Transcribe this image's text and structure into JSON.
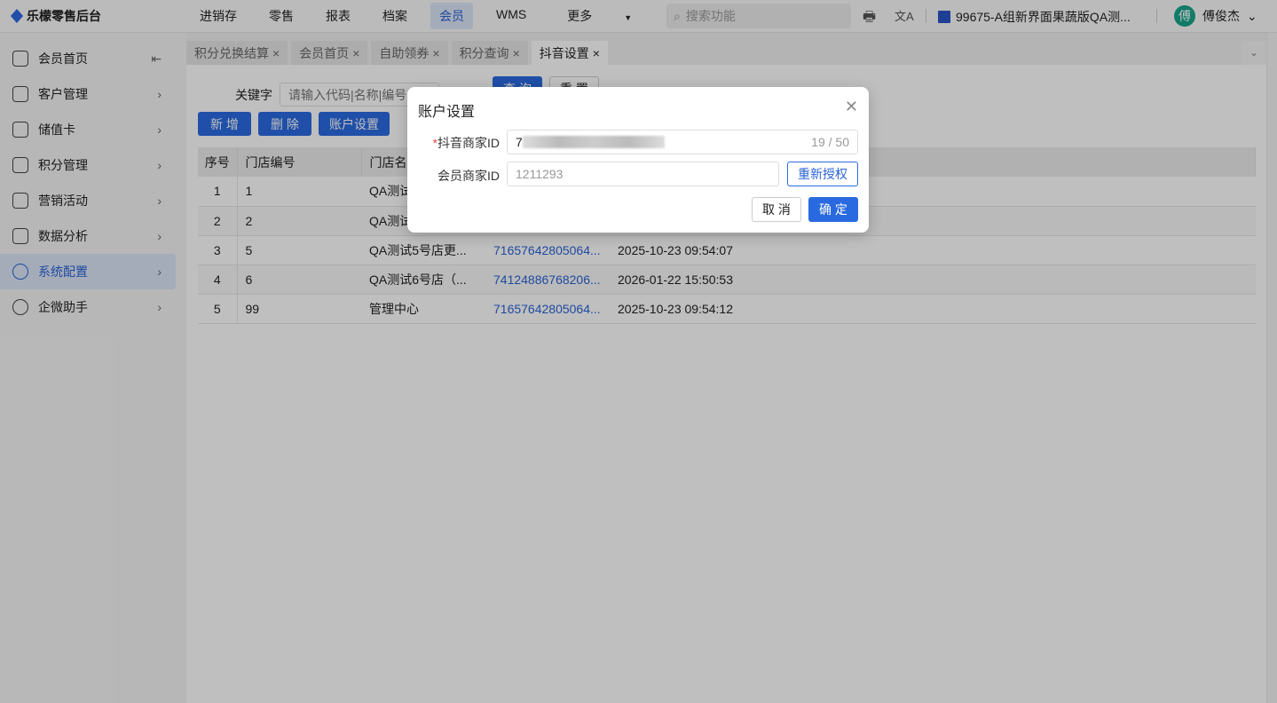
{
  "app": {
    "title": "乐檬零售后台"
  },
  "nav": [
    "进销存",
    "零售",
    "报表",
    "档案",
    "会员",
    "WMS",
    "更多"
  ],
  "nav_active": "会员",
  "search": {
    "placeholder": "搜索功能"
  },
  "store": "99675-A组新界面果蔬版QA测...",
  "user": {
    "avatar": "傅",
    "name": "傅俊杰"
  },
  "sidebar": [
    {
      "label": "会员首页"
    },
    {
      "label": "客户管理"
    },
    {
      "label": "储值卡"
    },
    {
      "label": "积分管理"
    },
    {
      "label": "营销活动"
    },
    {
      "label": "数据分析"
    },
    {
      "label": "系统配置"
    },
    {
      "label": "企微助手"
    }
  ],
  "tabs": [
    "积分兑换结算",
    "会员首页",
    "自助领券",
    "积分查询",
    "抖音设置"
  ],
  "filter": {
    "label": "关键字",
    "placeholder": "请输入代码|名称|编号",
    "query": "查 询",
    "reset": "重 置"
  },
  "toolbar": {
    "add": "新 增",
    "delete": "删 除",
    "account": "账户设置"
  },
  "table": {
    "headers": [
      "序号",
      "门店编号",
      "门店名"
    ],
    "rows": [
      [
        "1",
        "1",
        "QA测试",
        "",
        ""
      ],
      [
        "2",
        "2",
        "QA测试",
        "",
        ""
      ],
      [
        "3",
        "5",
        "QA测试5号店更...",
        "71657642805064...",
        "2025-10-23 09:54:07"
      ],
      [
        "4",
        "6",
        "QA测试6号店（...",
        "74124886768206...",
        "2026-01-22 15:50:53"
      ],
      [
        "5",
        "99",
        "管理中心",
        "71657642805064...",
        "2025-10-23 09:54:12"
      ]
    ]
  },
  "dialog": {
    "title": "账户设置",
    "douyin_label": "抖音商家ID",
    "douyin_value": "7",
    "douyin_count": "19 / 50",
    "member_label": "会员商家ID",
    "member_placeholder": "1211293",
    "reauth": "重新授权",
    "cancel": "取 消",
    "ok": "确 定"
  }
}
